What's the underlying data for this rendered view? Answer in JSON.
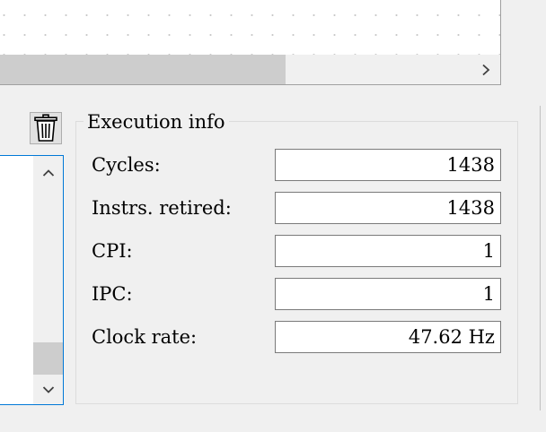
{
  "execution_info": {
    "title": "Execution info",
    "rows": [
      {
        "label": "Cycles:",
        "value": "1438"
      },
      {
        "label": "Instrs. retired:",
        "value": "1438"
      },
      {
        "label": "CPI:",
        "value": "1"
      },
      {
        "label": "IPC:",
        "value": "1"
      },
      {
        "label": "Clock rate:",
        "value": "47.62 Hz"
      }
    ]
  },
  "icons": {
    "trash": "trash-icon",
    "scroll_right": "chevron-right-icon",
    "scroll_up": "chevron-up-icon",
    "scroll_down": "chevron-down-icon"
  },
  "colors": {
    "window_bg": "#f0f0f0",
    "focus_border": "#0078d7",
    "scroll_thumb": "#cdcdcd"
  }
}
